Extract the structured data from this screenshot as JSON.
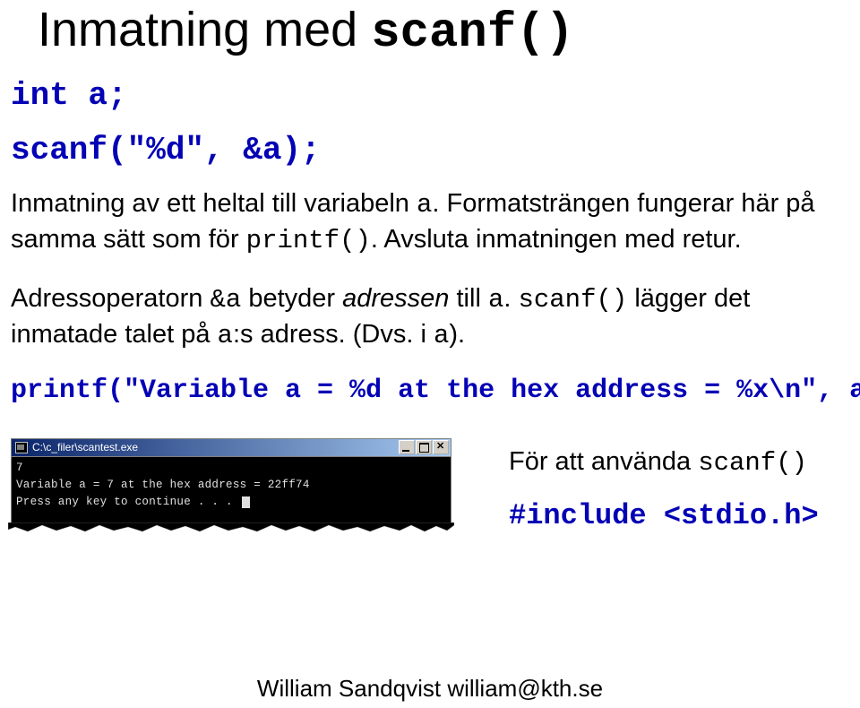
{
  "title": {
    "part1": "Inmatning med ",
    "part2": "scanf()"
  },
  "code": {
    "decl": "int a;",
    "scanf": "scanf(\"%d\", &a);",
    "printf": "printf(\"Variable a = %d at the hex address = %x\\n\", a, &a);"
  },
  "para1": {
    "t1": "Inmatning av ett heltal till variabeln ",
    "c1": "a",
    "t2": ". Formatsträngen fungerar här på samma sätt som för ",
    "c2": "printf()",
    "t3": ". Avsluta inmatningen med retur."
  },
  "para2": {
    "t1": "Adressoperatorn ",
    "c1": "&a",
    "t2": " betyder ",
    "i1": "adressen",
    "t3": "  till ",
    "c2": "a",
    "t4": ". ",
    "c3": "scanf()",
    "t5": " lägger det inmatade talet på ",
    "c4": "a",
    "t6": ":s adress. (Dvs. i ",
    "c5": "a",
    "t7": ")."
  },
  "console": {
    "title_path": "C:\\c_filer\\scantest.exe",
    "line1": "7",
    "line2": "Variable a = 7 at the hex address = 22ff74",
    "line3": "Press any key to continue . . . "
  },
  "right": {
    "line1": "För att använda ",
    "code1": "scanf()",
    "include": "#include <stdio.h>"
  },
  "footer": "William Sandqvist  william@kth.se"
}
